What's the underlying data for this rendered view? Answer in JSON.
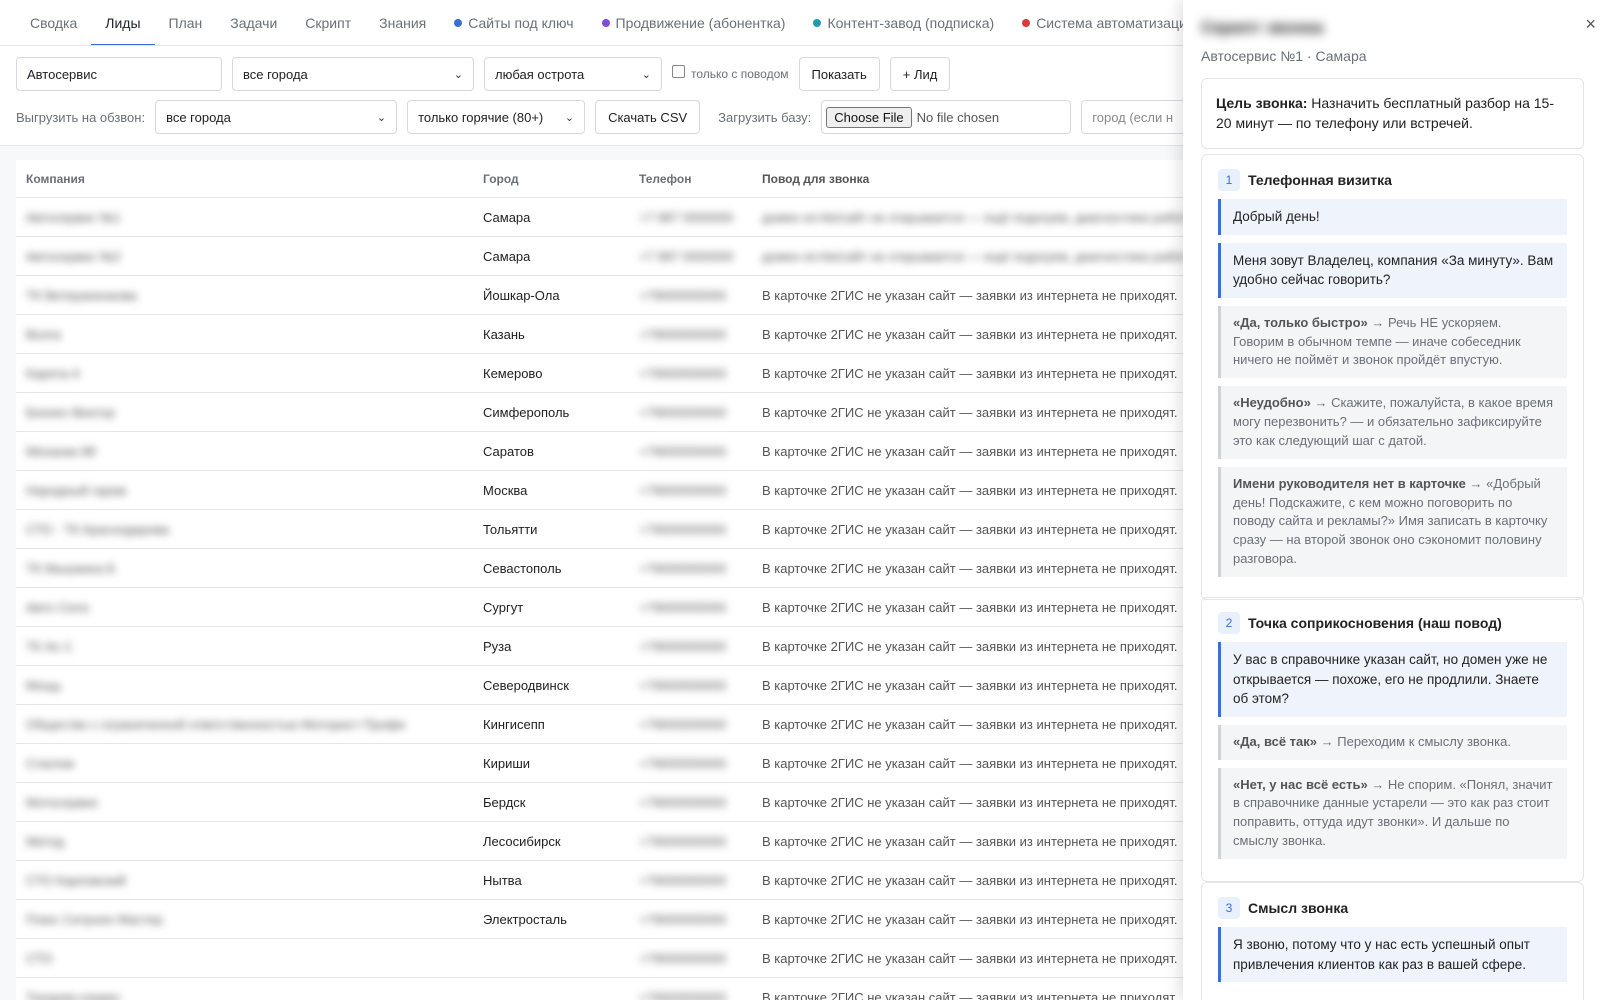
{
  "nav": {
    "tabs": [
      {
        "label": "Сводка",
        "active": false,
        "dot": null
      },
      {
        "label": "Лиды",
        "active": true,
        "dot": null
      },
      {
        "label": "План",
        "active": false,
        "dot": null
      },
      {
        "label": "Задачи",
        "active": false,
        "dot": null
      },
      {
        "label": "Скрипт",
        "active": false,
        "dot": null
      },
      {
        "label": "Знания",
        "active": false,
        "dot": null
      },
      {
        "label": "Сайты под ключ",
        "active": false,
        "dot": "#3b6fd6"
      },
      {
        "label": "Продвижение (абонентка)",
        "active": false,
        "dot": "#7b4fd6"
      },
      {
        "label": "Контент-завод (подписка)",
        "active": false,
        "dot": "#1f9bb0"
      },
      {
        "label": "Система автоматизации",
        "active": false,
        "dot": "#d63b3b"
      }
    ]
  },
  "filters": {
    "search_value": "Автосервис",
    "city_select": "все города",
    "heat_select": "любая острота",
    "only_reason_label": "только с поводом",
    "show_button": "Показать",
    "add_lead_button": "+ Лид"
  },
  "export": {
    "label": "Выгрузить на обзвон:",
    "city_select": "все города",
    "heat_select": "только горячие (80+)",
    "download_button": "Скачать CSV",
    "upload_label": "Загрузить базу:",
    "file_button": "Choose File",
    "file_text": "No file chosen",
    "city_placeholder": "город (если н"
  },
  "table": {
    "headers": {
      "company": "Компания",
      "city": "Город",
      "phone": "Телефон",
      "reason": "Повод для звонка"
    },
    "rows": [
      {
        "company": "Автосервис №1",
        "city": "Самара",
        "phone": "+7 987 0000000",
        "reason": "домен истёк/сайт не открывается — ещё подогрев, диагностика работ",
        "blur_reason": true
      },
      {
        "company": "Автосервис №2",
        "city": "Самара",
        "phone": "+7 987 0000000",
        "reason": "домен истёк/сайт не открывается — ещё подогрев, диагностика работ",
        "blur_reason": true
      },
      {
        "company": "ТК Ветераненкова",
        "city": "Йошкар-Ола",
        "phone": "+79000000000",
        "reason": "В карточке 2ГИС не указан сайт — заявки из интернета не приходят.",
        "blur_reason": false
      },
      {
        "company": "Волга",
        "city": "Казань",
        "phone": "+79000000000",
        "reason": "В карточке 2ГИС не указан сайт — заявки из интернета не приходят.",
        "blur_reason": false
      },
      {
        "company": "Карета-4",
        "city": "Кемерово",
        "phone": "+79000000000",
        "reason": "В карточке 2ГИС не указан сайт — заявки из интернета не приходят.",
        "blur_reason": false
      },
      {
        "company": "Бизнес-Вектор",
        "city": "Симферополь",
        "phone": "+79000000000",
        "reason": "В карточке 2ГИС не указан сайт — заявки из интернета не приходят.",
        "blur_reason": false
      },
      {
        "company": "Механик 88",
        "city": "Саратов",
        "phone": "+79000000000",
        "reason": "В карточке 2ГИС не указан сайт — заявки из интернета не приходят.",
        "blur_reason": false
      },
      {
        "company": "Народный гараж",
        "city": "Москва",
        "phone": "+79000000000",
        "reason": "В карточке 2ГИС не указан сайт — заявки из интернета не приходят.",
        "blur_reason": false
      },
      {
        "company": "СТО · ТК Краснодарова",
        "city": "Тольятти",
        "phone": "+79000000000",
        "reason": "В карточке 2ГИС не указан сайт — заявки из интернета не приходят.",
        "blur_reason": false
      },
      {
        "company": "ТК Мышкина Б",
        "city": "Севастополь",
        "phone": "+79000000000",
        "reason": "В карточке 2ГИС не указан сайт — заявки из интернета не приходят.",
        "blur_reason": false
      },
      {
        "company": "Авто Село",
        "city": "Сургут",
        "phone": "+79000000000",
        "reason": "В карточке 2ГИС не указан сайт — заявки из интернета не приходят.",
        "blur_reason": false
      },
      {
        "company": "ТК Ас-1",
        "city": "Руза",
        "phone": "+79000000000",
        "reason": "В карточке 2ГИС не указан сайт — заявки из интернета не приходят.",
        "blur_reason": false
      },
      {
        "company": "Мощь",
        "city": "Северодвинск",
        "phone": "+79000000000",
        "reason": "В карточке 2ГИС не указан сайт — заявки из интернета не приходят.",
        "blur_reason": false
      },
      {
        "company": "Общество с ограниченной ответственностью Моторист Профи",
        "city": "Кингисепп",
        "phone": "+79000000000",
        "reason": "В карточке 2ГИС не указан сайт — заявки из интернета не приходят.",
        "blur_reason": false
      },
      {
        "company": "Слалом",
        "city": "Кириши",
        "phone": "+79000000000",
        "reason": "В карточке 2ГИС не указан сайт — заявки из интернета не приходят.",
        "blur_reason": false
      },
      {
        "company": "Мотосервис",
        "city": "Бердск",
        "phone": "+79000000000",
        "reason": "В карточке 2ГИС не указан сайт — заявки из интернета не приходят.",
        "blur_reason": false
      },
      {
        "company": "Метод",
        "city": "Лесосибирск",
        "phone": "+79000000000",
        "reason": "В карточке 2ГИС не указан сайт — заявки из интернета не приходят.",
        "blur_reason": false
      },
      {
        "company": "СТО Карповский",
        "city": "Нытва",
        "phone": "+79000000000",
        "reason": "В карточке 2ГИС не указан сайт — заявки из интернета не приходят.",
        "blur_reason": false
      },
      {
        "company": "Плюс Ситроен Мастер",
        "city": "Электросталь",
        "phone": "+79000000000",
        "reason": "В карточке 2ГИС не указан сайт — заявки из интернета не приходят.",
        "blur_reason": false
      },
      {
        "company": "СТО",
        "city": "",
        "phone": "+79000000000",
        "reason": "В карточке 2ГИС не указан сайт — заявки из интернета не приходят.",
        "blur_reason": false
      },
      {
        "company": "Токарев-сервис",
        "city": "",
        "phone": "+79000000000",
        "reason": "В карточке 2ГИС не указан сайт — заявки из интернета не приходят.",
        "blur_reason": false
      }
    ]
  },
  "panel": {
    "title": "Скрипт звонка",
    "close": "×",
    "subtitle": "Автосервис №1 · Самара",
    "goal_label": "Цель звонка:",
    "goal_text": " Назначить бесплатный разбор на 15-20 минут — по телефону или встречей.",
    "steps": [
      {
        "num": "1",
        "title": "Телефонная визитка",
        "say": [
          "Добрый день!",
          "Меня зовут Владелец, компания «За минуту». Вам удобно сейчас говорить?"
        ],
        "alts": [
          {
            "label": "«Да, только быстро»",
            "text": " → Речь НЕ ускоряем. Говорим в обычном темпе — иначе собеседник ничего не поймёт и звонок пройдёт впустую."
          },
          {
            "label": "«Неудобно»",
            "text": " → Скажите, пожалуйста, в какое время могу перезвонить? — и обязательно зафиксируйте это как следующий шаг с датой."
          },
          {
            "label": "Имени руководителя нет в карточке",
            "text": " → «Добрый день! Подскажите, с кем можно поговорить по поводу сайта и рекламы?» Имя записать в карточку сразу — на второй звонок оно сэкономит половину разговора."
          }
        ]
      },
      {
        "num": "2",
        "title": "Точка соприкосновения (наш повод)",
        "say": [
          "У вас в справочнике указан сайт, но домен уже не открывается — похоже, его не продлили. Знаете об этом?"
        ],
        "alts": [
          {
            "label": "«Да, всё так»",
            "text": " → Переходим к смыслу звонка."
          },
          {
            "label": "«Нет, у нас всё есть»",
            "text": " → Не спорим. «Понял, значит в справочнике данные устарели — это как раз стоит поправить, оттуда идут звонки». И дальше по смыслу звонка."
          }
        ]
      },
      {
        "num": "3",
        "title": "Смысл звонка",
        "say": [
          "Я звоню, потому что у нас есть успешный опыт привлечения клиентов как раз в вашей сфере."
        ],
        "alts": []
      }
    ]
  }
}
